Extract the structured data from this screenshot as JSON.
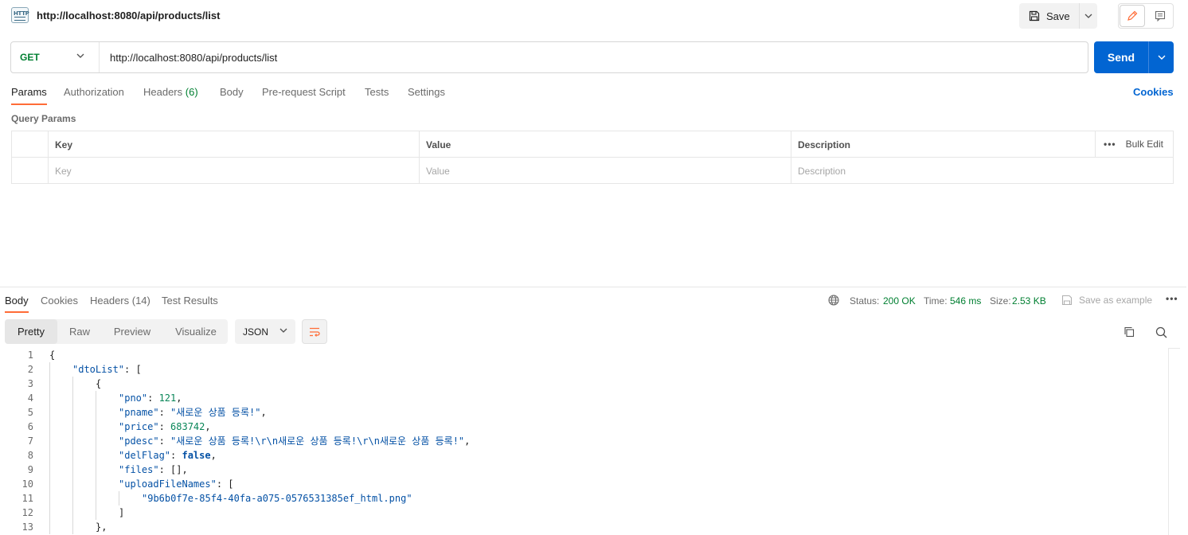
{
  "tab": {
    "title": "http://localhost:8080/api/products/list",
    "badge_icon": "http-icon",
    "badge_text": "HTTP"
  },
  "toolbar": {
    "save_label": "Save",
    "save_icon": "save-icon"
  },
  "request": {
    "method": "GET",
    "url": "http://localhost:8080/api/products/list",
    "send_label": "Send"
  },
  "request_tabs": [
    {
      "label": "Params",
      "active": true
    },
    {
      "label": "Authorization"
    },
    {
      "label": "Headers",
      "count": "(6)"
    },
    {
      "label": "Body"
    },
    {
      "label": "Pre-request Script"
    },
    {
      "label": "Tests"
    },
    {
      "label": "Settings"
    }
  ],
  "cookies_label": "Cookies",
  "query_params": {
    "title": "Query Params",
    "headers": [
      "Key",
      "Value",
      "Description"
    ],
    "placeholders": [
      "Key",
      "Value",
      "Description"
    ],
    "bulk_edit": "Bulk Edit"
  },
  "response": {
    "tabs": [
      {
        "label": "Body",
        "active": true
      },
      {
        "label": "Cookies"
      },
      {
        "label": "Headers (14)"
      },
      {
        "label": "Test Results"
      }
    ],
    "status_label": "Status:",
    "status_value": "200 OK",
    "time_label": "Time:",
    "time_value": "546 ms",
    "size_label": "Size:",
    "size_value": "2.53 KB",
    "save_example": "Save as example",
    "view_tabs": [
      {
        "label": "Pretty",
        "active": true
      },
      {
        "label": "Raw"
      },
      {
        "label": "Preview"
      },
      {
        "label": "Visualize"
      }
    ],
    "format": "JSON"
  },
  "code_lines": [
    {
      "n": "1",
      "indent": 0,
      "parts": [
        [
          "punc",
          "{"
        ]
      ]
    },
    {
      "n": "2",
      "indent": 1,
      "parts": [
        [
          "key",
          "\"dtoList\""
        ],
        [
          "punc",
          ": ["
        ]
      ]
    },
    {
      "n": "3",
      "indent": 2,
      "parts": [
        [
          "punc",
          "{"
        ]
      ]
    },
    {
      "n": "4",
      "indent": 3,
      "parts": [
        [
          "key",
          "\"pno\""
        ],
        [
          "punc",
          ": "
        ],
        [
          "num",
          "121"
        ],
        [
          "punc",
          ","
        ]
      ]
    },
    {
      "n": "5",
      "indent": 3,
      "parts": [
        [
          "key",
          "\"pname\""
        ],
        [
          "punc",
          ": "
        ],
        [
          "strv",
          "\"새로운 상품 등록!\""
        ],
        [
          "punc",
          ","
        ]
      ]
    },
    {
      "n": "6",
      "indent": 3,
      "parts": [
        [
          "key",
          "\"price\""
        ],
        [
          "punc",
          ": "
        ],
        [
          "num",
          "683742"
        ],
        [
          "punc",
          ","
        ]
      ]
    },
    {
      "n": "7",
      "indent": 3,
      "parts": [
        [
          "key",
          "\"pdesc\""
        ],
        [
          "punc",
          ": "
        ],
        [
          "strv",
          "\"새로운 상품 등록!\\r\\n새로운 상품 등록!\\r\\n새로운 상품 등록!\""
        ],
        [
          "punc",
          ","
        ]
      ]
    },
    {
      "n": "8",
      "indent": 3,
      "parts": [
        [
          "key",
          "\"delFlag\""
        ],
        [
          "punc",
          ": "
        ],
        [
          "bool",
          "false"
        ],
        [
          "punc",
          ","
        ]
      ]
    },
    {
      "n": "9",
      "indent": 3,
      "parts": [
        [
          "key",
          "\"files\""
        ],
        [
          "punc",
          ": [],"
        ]
      ]
    },
    {
      "n": "10",
      "indent": 3,
      "parts": [
        [
          "key",
          "\"uploadFileNames\""
        ],
        [
          "punc",
          ": ["
        ]
      ]
    },
    {
      "n": "11",
      "indent": 4,
      "parts": [
        [
          "strv",
          "\"9b6b0f7e-85f4-40fa-a075-0576531385ef_html.png\""
        ]
      ]
    },
    {
      "n": "12",
      "indent": 3,
      "parts": [
        [
          "punc",
          "]"
        ]
      ]
    },
    {
      "n": "13",
      "indent": 2,
      "parts": [
        [
          "punc",
          "},"
        ]
      ]
    }
  ],
  "colors": {
    "accent": "#ff6c37",
    "send": "#0265d2",
    "method_get": "#007f31",
    "status_ok": "#007f31"
  }
}
